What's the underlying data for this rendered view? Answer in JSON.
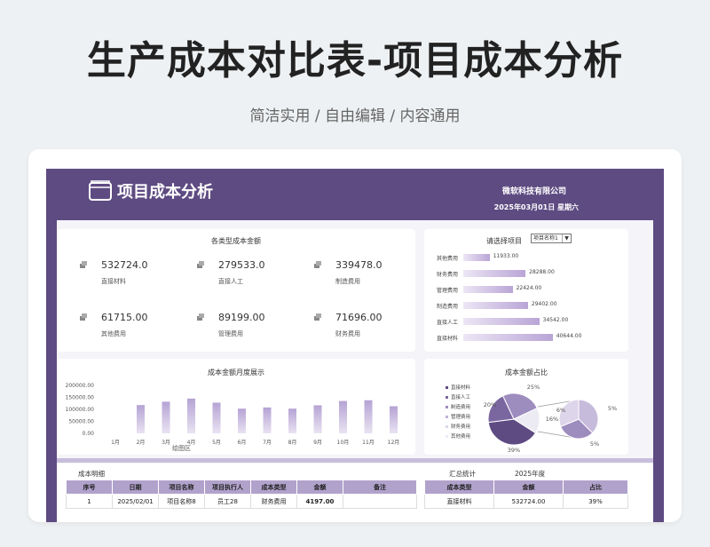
{
  "banner": {
    "title": "生产成本对比表-项目成本分析",
    "subtitle": "简洁实用 / 自由编辑 / 内容通用"
  },
  "header": {
    "title": "项目成本分析",
    "company": "微软科技有限公司",
    "date": "2025年03月01日  星期六",
    "icon": "folder-icon"
  },
  "kpi": {
    "title": "各类型成本金额",
    "items": [
      {
        "value": "532724.0",
        "label": "直接材料"
      },
      {
        "value": "279533.0",
        "label": "直接人工"
      },
      {
        "value": "339478.0",
        "label": "制造费用"
      },
      {
        "value": "61715.00",
        "label": "其他费用"
      },
      {
        "value": "89199.00",
        "label": "管理费用"
      },
      {
        "value": "71696.00",
        "label": "财务费用"
      }
    ]
  },
  "project_select": {
    "title": "请选择项目",
    "selected": "项目名称1",
    "chart_data": {
      "type": "bar",
      "orientation": "horizontal",
      "categories": [
        "其他费用",
        "财务费用",
        "管理费用",
        "制造费用",
        "直接人工",
        "直接材料"
      ],
      "values": [
        11933.0,
        28288.0,
        22424.0,
        29402.0,
        34542.0,
        40644.0
      ],
      "labels": [
        "11933.00",
        "28288.00",
        "22424.00",
        "29402.00",
        "34542.00",
        "40644.00"
      ]
    }
  },
  "monthly": {
    "title": "成本金额月度展示",
    "plot_area_label": "绘图区",
    "chart_data": {
      "type": "bar",
      "categories": [
        "1月",
        "2月",
        "3月",
        "4月",
        "5月",
        "6月",
        "7月",
        "8月",
        "9月",
        "10月",
        "11月",
        "12月"
      ],
      "values": [
        0,
        118000,
        132000,
        145000,
        128000,
        103000,
        108000,
        103000,
        117000,
        135000,
        138000,
        113000
      ],
      "yticks": [
        "200000.00",
        "150000.00",
        "100000.00",
        "50000.00",
        "0.00"
      ],
      "ylim": [
        0,
        200000
      ]
    }
  },
  "ratio": {
    "title": "成本金额占比",
    "legend": [
      "直接材料",
      "直接人工",
      "制造费用",
      "管理费用",
      "财务费用",
      "其他费用"
    ],
    "chart_data": {
      "type": "pie",
      "main_labels": [
        "39%",
        "20%",
        "25%",
        "16%"
      ],
      "main_values": [
        39,
        20,
        25,
        16
      ],
      "sub_labels": [
        "6%",
        "5%",
        "5%"
      ],
      "sub_values": [
        6,
        5,
        5
      ]
    },
    "colors": [
      "#5e4b82",
      "#7b679f",
      "#9d8cbe",
      "#c0b3d7",
      "#ddd5ea",
      "#efebf5"
    ]
  },
  "detail": {
    "title": "成本明细",
    "headers": [
      "序号",
      "日期",
      "项目名称",
      "项目执行人",
      "成本类型",
      "金额",
      "备注"
    ],
    "rows": [
      [
        "1",
        "2025/02/01",
        "项目名称8",
        "员工28",
        "财务费用",
        "4197.00",
        ""
      ]
    ]
  },
  "summary": {
    "title": "汇总统计",
    "year": "2025年度",
    "headers": [
      "成本类型",
      "金额",
      "占比"
    ],
    "rows": [
      [
        "直接材料",
        "532724.00",
        "39%"
      ]
    ]
  }
}
